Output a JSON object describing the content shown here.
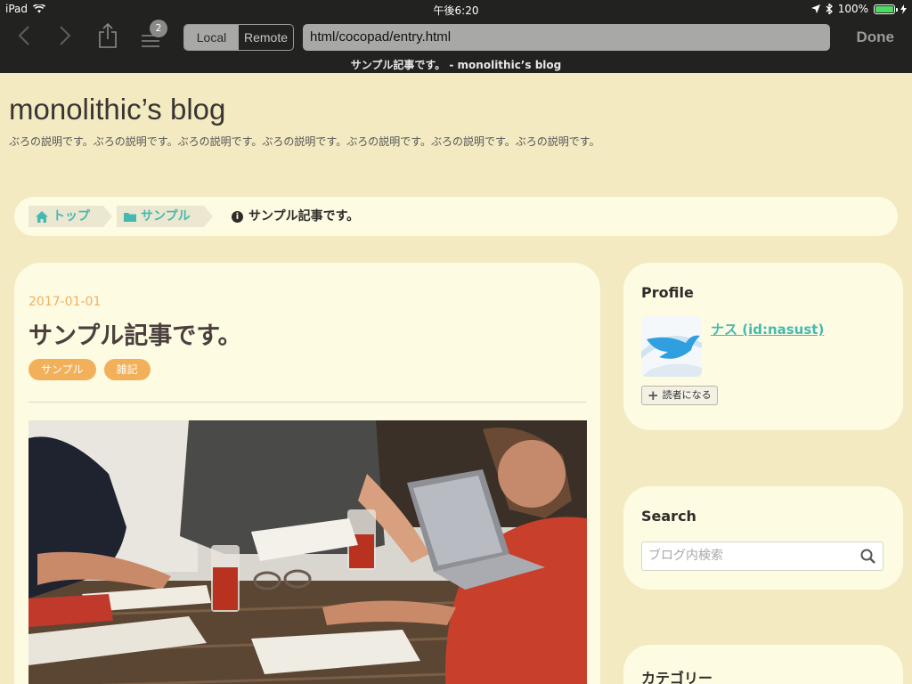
{
  "status_bar": {
    "device": "iPad",
    "time": "午後6:20",
    "battery": "100%",
    "battery_level": 1.0
  },
  "browser": {
    "tabs_count": "2",
    "segment": {
      "local": "Local",
      "remote": "Remote",
      "selected": "Local"
    },
    "url": "html/cocopad/entry.html",
    "done_label": "Done",
    "page_title": "サンプル記事です。 - monolithic’s blog"
  },
  "blog": {
    "title": "monolithic’s blog",
    "description": "ぶろの説明です。ぶろの説明です。ぶろの説明です。ぶろの説明です。ぶろの説明です。ぶろの説明です。ぶろの説明です。"
  },
  "breadcrumb": {
    "home": "トップ",
    "category": "サンプル",
    "current": "サンプル記事です。"
  },
  "article": {
    "date": "2017-01-01",
    "title": "サンプル記事です。",
    "tags": [
      "サンプル",
      "雑記"
    ]
  },
  "sidebar": {
    "profile": {
      "heading": "Profile",
      "name": "ナス (id:nasust)",
      "follow_label": "読者になる"
    },
    "search": {
      "heading": "Search",
      "placeholder": "ブログ内検索"
    },
    "category": {
      "heading": "カテゴリー"
    }
  },
  "colors": {
    "page_background": "#f3eac2",
    "card_background": "#fefbe3",
    "accent_teal": "#45b9b0",
    "tag_orange": "#f2b05a",
    "date_orange": "#f0b060",
    "toolbar_dark": "#222220"
  }
}
